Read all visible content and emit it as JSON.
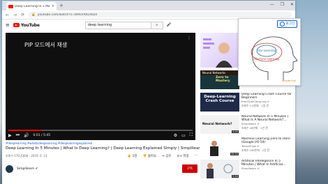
{
  "browser": {
    "tab_title": "Deep Learning In 5 Minutes",
    "tab_close": "×",
    "new_tab": "+",
    "window_controls": [
      "—",
      "❐",
      "✕"
    ],
    "url": "youtube.com/watch?v=6M5VXKLf4D4",
    "nav": [
      "←",
      "→",
      "⟳"
    ]
  },
  "youtube": {
    "logo_text": "YouTube",
    "search_value": "deep learning",
    "search_icon": "search-icon",
    "mic_icon": "mic-icon"
  },
  "player": {
    "pip_text": "PIP 모드에서 재생",
    "time": "0:01 / 5:45",
    "progress": 0.18,
    "controls": [
      "▶",
      "⏭",
      "🔊"
    ],
    "right_controls": [
      "⚙",
      "▭",
      "⛶"
    ]
  },
  "video": {
    "hashtags": "#deeplearning #whatisdeeplearning #deeplearningexplained",
    "title": "Deep Learning In 5 Minutes | What Is Deep Learning? | Deep Learning Explained Simply | Simplilearn",
    "views": "조회수 570,436회 · 2019. 6. 13.",
    "likes": "1천",
    "dislikes": "싫어요",
    "share": "공유",
    "save": "저장",
    "more": "···",
    "channel_name": "Simplilearn ✔",
    "subscribe": "구독"
  },
  "sidebar": {
    "items": [
      {
        "title": "",
        "channel": "",
        "meta": "",
        "duration": "",
        "thumb_text": ""
      },
      {
        "title": "Neural Networks",
        "channel": "",
        "meta": "",
        "duration": "",
        "thumb_text": "Zero to Mastery"
      },
      {
        "title": "Deep Learning Crash Course for Beginners",
        "channel": "freeCodeCamp.org ✔",
        "meta": "조회수 1.4만회 · 1일 전",
        "duration": "",
        "thumb_text": "Deep-Learning Crash Course"
      },
      {
        "title": "Neural Network In 5 Minutes | What Is A Neural Network?...",
        "channel": "Simplilearn ✔",
        "meta": "조회수 48만회 · 1년 전",
        "duration": "5:45",
        "thumb_text": "Neural Network?"
      },
      {
        "title": "Machine Learning Zero to Hero (Google I/O'19)",
        "channel": "TensorFlow ✔",
        "meta": "조회수 162만회 · 2년 전",
        "duration": "35:33",
        "thumb_text": ""
      },
      {
        "title": "Artificial Intelligence In 5 Minutes | What Is Artificial...",
        "channel": "Simplilearn ✔",
        "meta": "",
        "duration": "5:44",
        "thumb_text": ""
      }
    ]
  },
  "popup": {
    "login_label": "로그인",
    "brain_text_1": "Use Learning",
    "brain_text_2": "Machine Learning",
    "corner_text": "Wunderlust"
  },
  "colors": {
    "yt_red": "#ff0000",
    "link_blue": "#065fd4",
    "subscribe_red": "#cc0000"
  }
}
